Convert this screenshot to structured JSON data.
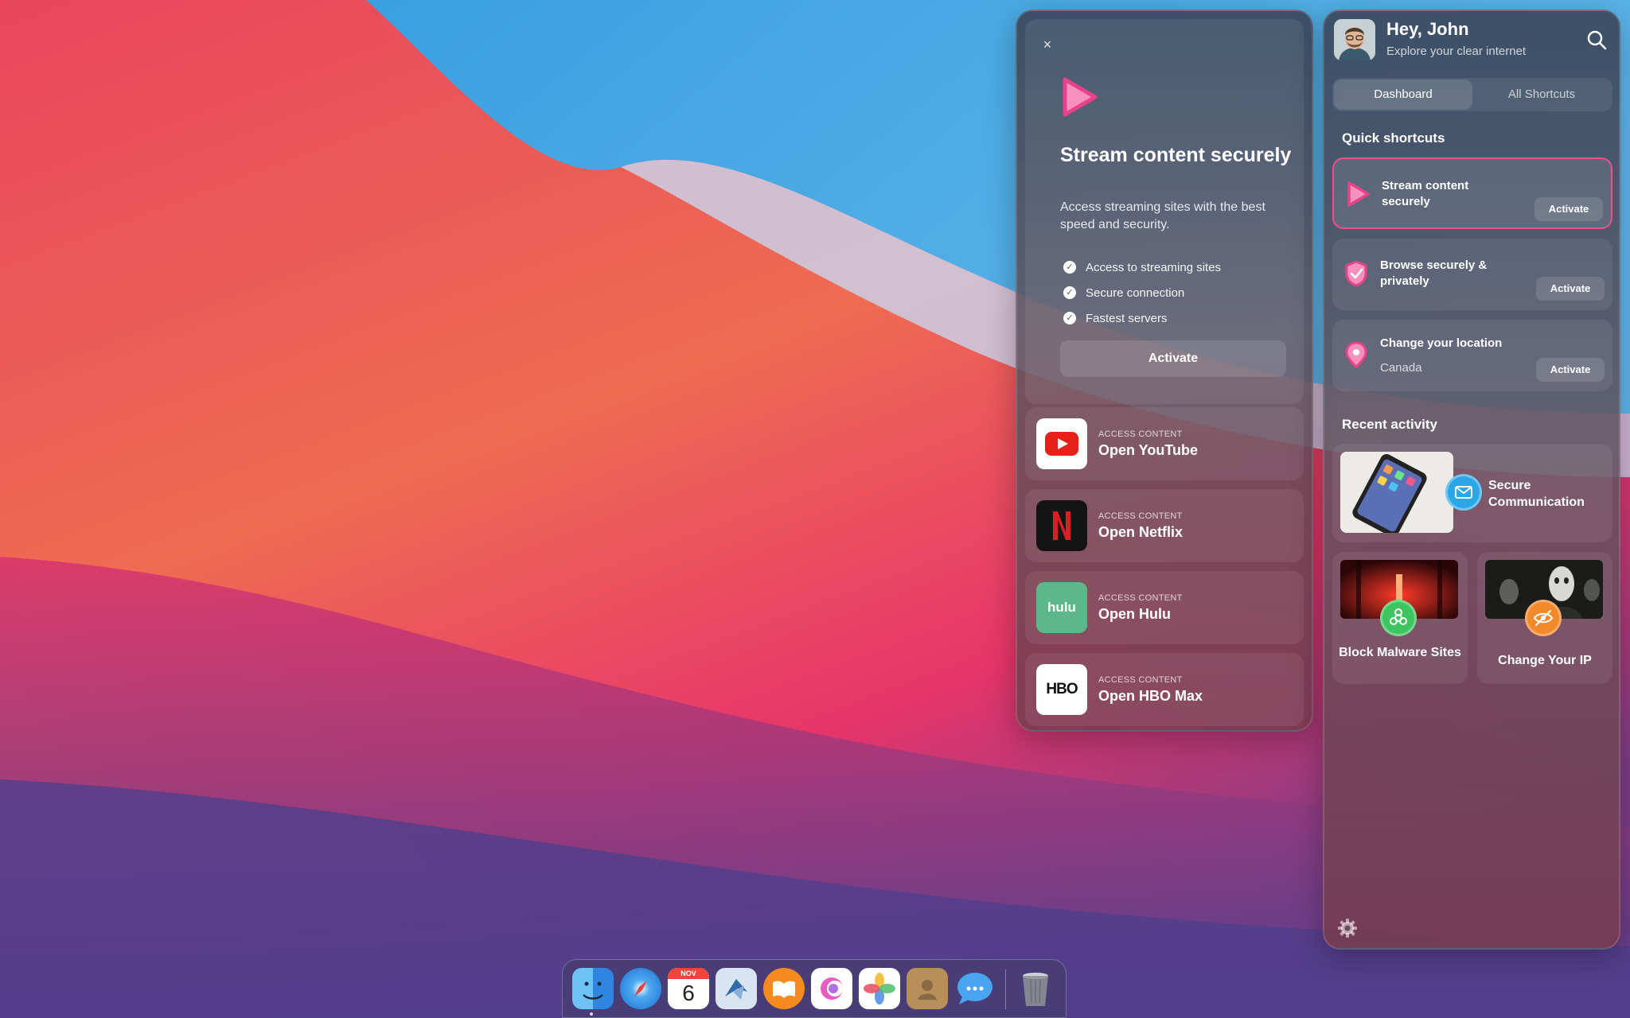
{
  "detail": {
    "close_label": "×",
    "title": "Stream content securely",
    "description": "Access streaming sites with the best speed and security.",
    "features": [
      "Access to streaming sites",
      "Secure connection",
      "Fastest servers"
    ],
    "activate_label": "Activate",
    "services": [
      {
        "kicker": "ACCESS CONTENT",
        "name": "Open YouTube",
        "icon": "youtube-icon"
      },
      {
        "kicker": "ACCESS CONTENT",
        "name": "Open Netflix",
        "icon": "netflix-icon"
      },
      {
        "kicker": "ACCESS CONTENT",
        "name": "Open Hulu",
        "icon": "hulu-icon",
        "logo_text": "hulu"
      },
      {
        "kicker": "ACCESS CONTENT",
        "name": "Open HBO Max",
        "icon": "hbo-icon",
        "logo_text": "HBO"
      }
    ]
  },
  "main": {
    "greeting": "Hey, John",
    "subtitle": "Explore your clear internet",
    "tabs": [
      {
        "label": "Dashboard",
        "active": true
      },
      {
        "label": "All Shortcuts",
        "active": false
      }
    ],
    "quick_title": "Quick shortcuts",
    "shortcuts": [
      {
        "label": "Stream content securely",
        "sub": "",
        "action": "Activate",
        "icon": "play-icon",
        "selected": true
      },
      {
        "label": "Browse securely & privately",
        "sub": "",
        "action": "Activate",
        "icon": "shield-icon",
        "selected": false
      },
      {
        "label": "Change your location",
        "sub": "Canada",
        "action": "Activate",
        "icon": "location-pin-icon",
        "selected": false
      }
    ],
    "recent_title": "Recent activity",
    "recent": {
      "label": "Secure Communication",
      "icon": "mail-icon"
    },
    "tiles": [
      {
        "label": "Block Malware Sites",
        "icon": "biohazard-icon"
      },
      {
        "label": "Change Your IP",
        "icon": "eye-off-icon"
      }
    ]
  },
  "dock": {
    "apps": [
      "finder-icon",
      "safari-icon",
      "calendar-icon",
      "mail-app-icon",
      "books-icon",
      "app-icon",
      "photos-icon",
      "contacts-icon",
      "messages-icon",
      "trash-icon"
    ],
    "calendar_month": "NOV",
    "calendar_day": "6"
  },
  "colors": {
    "accent_pink": "#f0508a",
    "youtube_red": "#e62117",
    "netflix_red": "#d81f26",
    "hulu_green": "#5cb88a",
    "mail_blue": "#2aa7e6",
    "malware_green": "#3fc55f",
    "ip_orange": "#f28a2c"
  }
}
